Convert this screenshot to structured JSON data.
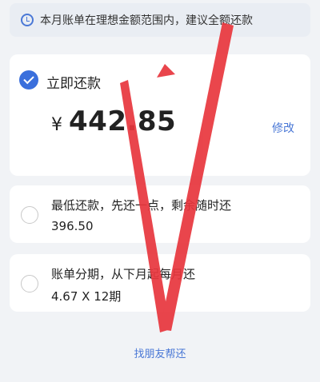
{
  "tip": {
    "text": "本月账单在理想金额范围内，建议全额还款",
    "icon": "clock-refresh-icon"
  },
  "repay_now": {
    "label": "立即还款",
    "currency": "¥",
    "amount": "442.85",
    "edit_label": "修改",
    "selected": true
  },
  "min_repay": {
    "label": "最低还款，先还一点，剩余随时还",
    "amount": "396.50",
    "selected": false
  },
  "installment": {
    "label": "账单分期，从下月起每月还",
    "detail": "4.67 X 12期",
    "selected": false
  },
  "friend_link": "找朋友帮还",
  "colors": {
    "accent": "#3a6fdc",
    "annotation": "#e8363d"
  }
}
